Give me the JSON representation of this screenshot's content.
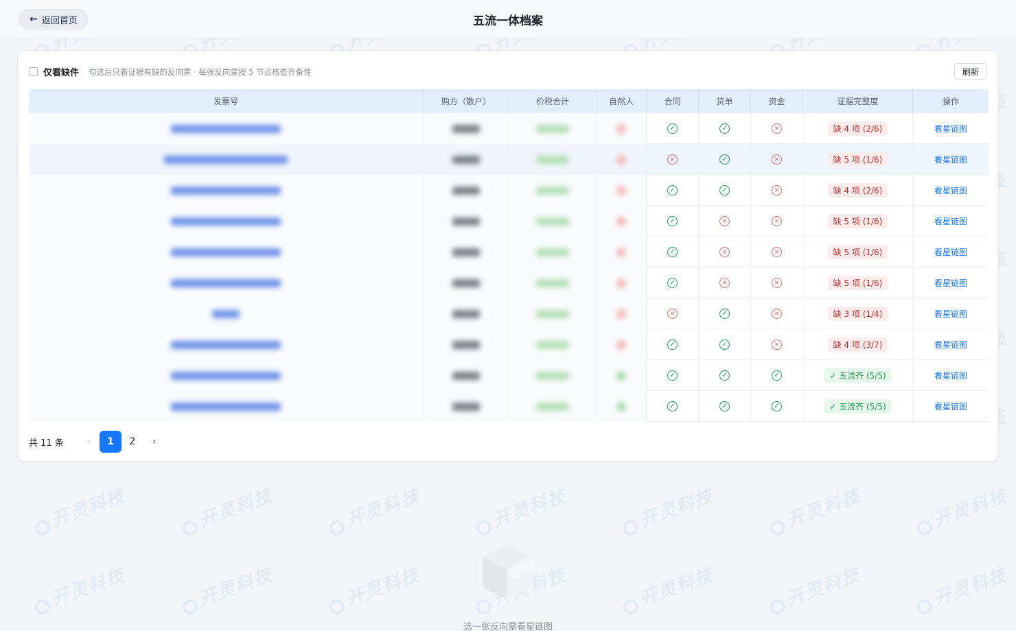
{
  "header": {
    "back_label": "返回首页",
    "title": "五流一体档案"
  },
  "toolbar": {
    "checkbox_label": "仅看缺件",
    "hint": "勾选后只看证据有缺的反向票 · 每张反向票按 5 节点核查齐备性",
    "refresh_label": "刷新"
  },
  "table": {
    "columns": [
      "发票号",
      "购方（散户）",
      "价税合计",
      "自然人",
      "合同",
      "货单",
      "资金",
      "证据完整度",
      "操作"
    ],
    "rows": [
      {
        "contract": "ok",
        "goods": "ok",
        "fund": "no",
        "completeness": "缺 4 项 (2/6)",
        "status": "bad",
        "action": "看星链图",
        "np": "red"
      },
      {
        "contract": "no",
        "goods": "ok",
        "fund": "no",
        "completeness": "缺 5 项 (1/6)",
        "status": "bad",
        "action": "看星链图",
        "np": "red"
      },
      {
        "contract": "ok",
        "goods": "ok",
        "fund": "no",
        "completeness": "缺 4 项 (2/6)",
        "status": "bad",
        "action": "看星链图",
        "np": "red"
      },
      {
        "contract": "ok",
        "goods": "no",
        "fund": "no",
        "completeness": "缺 5 项 (1/6)",
        "status": "bad",
        "action": "看星链图",
        "np": "red"
      },
      {
        "contract": "ok",
        "goods": "no",
        "fund": "no",
        "completeness": "缺 5 项 (1/6)",
        "status": "bad",
        "action": "看星链图",
        "np": "red"
      },
      {
        "contract": "ok",
        "goods": "no",
        "fund": "no",
        "completeness": "缺 5 项 (1/6)",
        "status": "bad",
        "action": "看星链图",
        "np": "red"
      },
      {
        "contract": "no",
        "goods": "ok",
        "fund": "no",
        "completeness": "缺 3 项 (1/4)",
        "status": "bad",
        "action": "看星链图",
        "np": "red"
      },
      {
        "contract": "ok",
        "goods": "ok",
        "fund": "no",
        "completeness": "缺 4 项 (3/7)",
        "status": "bad",
        "action": "看星链图",
        "np": "red"
      },
      {
        "contract": "ok",
        "goods": "ok",
        "fund": "ok",
        "completeness": "✓ 五流齐 (5/5)",
        "status": "good",
        "action": "看星链图",
        "np": "green"
      },
      {
        "contract": "ok",
        "goods": "ok",
        "fund": "ok",
        "completeness": "✓ 五流齐 (5/5)",
        "status": "good",
        "action": "看星链图",
        "np": "green"
      }
    ]
  },
  "pagination": {
    "total_label": "共 11 条",
    "prev": "‹",
    "pages": [
      "1",
      "2"
    ],
    "current": "1",
    "next": "›"
  },
  "empty_state": {
    "text": "选一张反向票看星链图"
  },
  "watermark": {
    "brand": "开灵科技"
  },
  "colors": {
    "accent": "#1677ff",
    "ok": "#1aa35a",
    "missing": "#e06a6a",
    "header_bg": "#e3eefc"
  }
}
